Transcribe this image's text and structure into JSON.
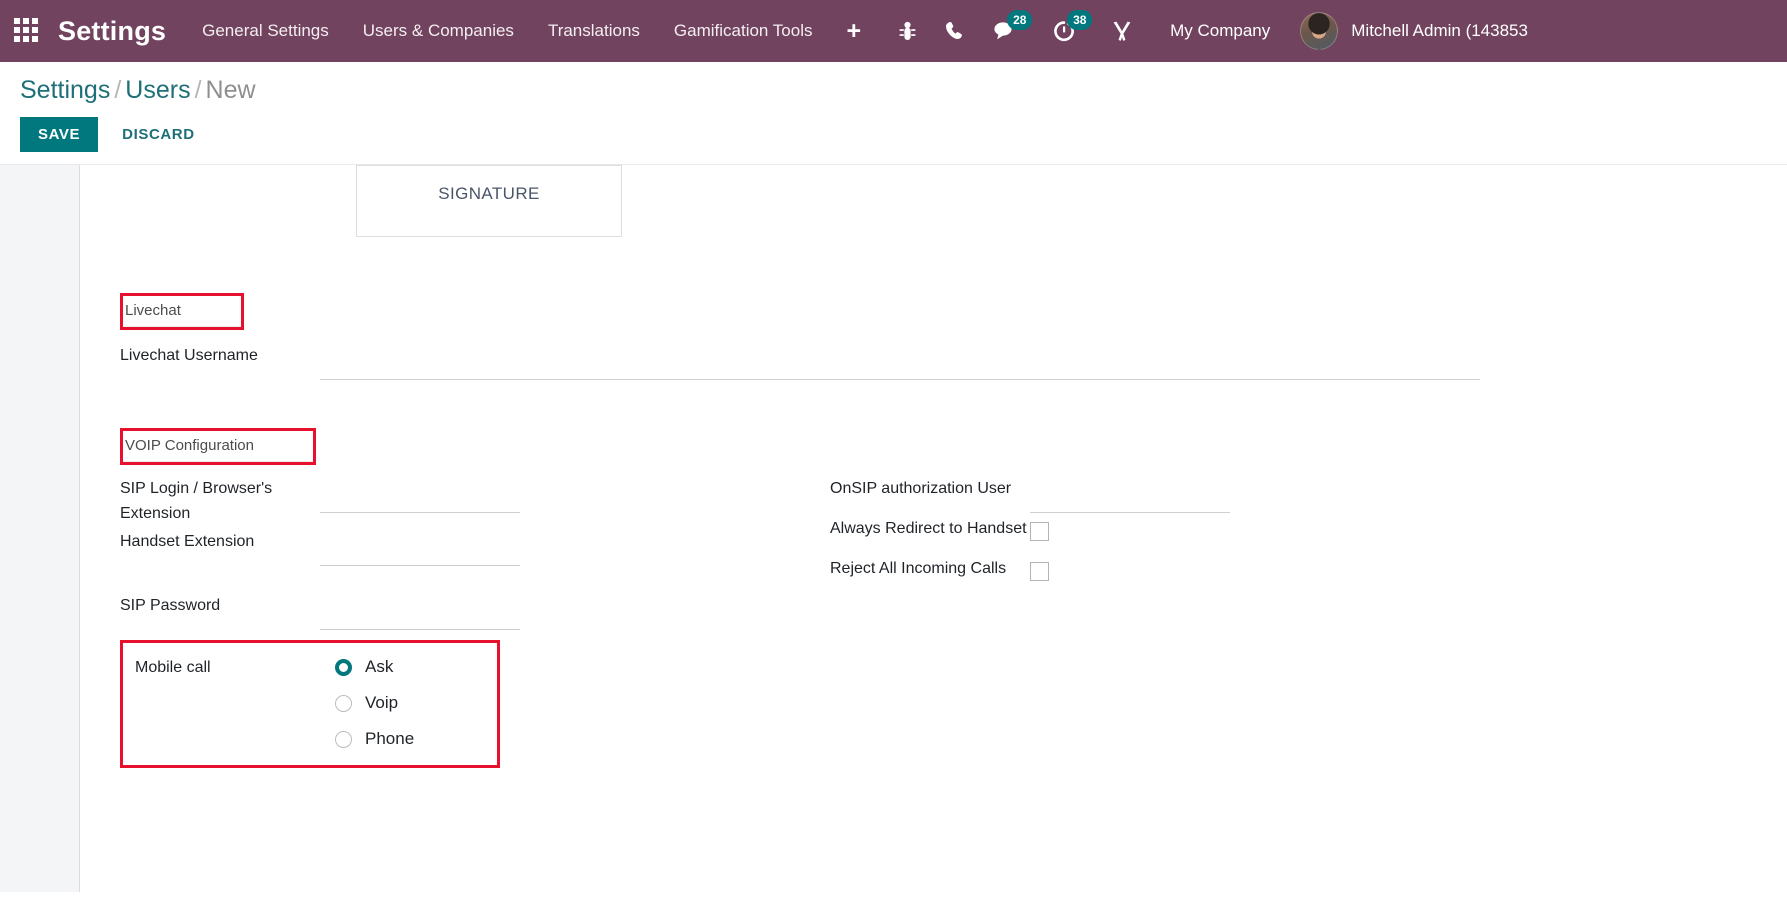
{
  "navbar": {
    "apps_icon": "apps-grid-icon",
    "brand": "Settings",
    "menu": [
      {
        "label": "General Settings"
      },
      {
        "label": "Users & Companies"
      },
      {
        "label": "Translations"
      },
      {
        "label": "Gamification Tools"
      }
    ],
    "plus_label": "+",
    "icons": [
      {
        "name": "bug-icon",
        "badge": null
      },
      {
        "name": "phone-icon",
        "badge": null
      },
      {
        "name": "messages-icon",
        "badge": "28"
      },
      {
        "name": "activities-clock-icon",
        "badge": "38"
      },
      {
        "name": "developer-tools-icon",
        "badge": null
      }
    ],
    "company": "My Company",
    "user_name": "Mitchell Admin (143853",
    "background_color": "#71435f",
    "badge_color": "#00787d"
  },
  "control_panel": {
    "breadcrumb": {
      "root": "Settings",
      "parent": "Users",
      "current": "New",
      "separator": "/"
    },
    "save_label": "SAVE",
    "discard_label": "DISCARD",
    "save_color": "#00787d"
  },
  "sheet": {
    "signature": {
      "label": "SIGNATURE"
    },
    "livechat": {
      "section_title": "Livechat",
      "username_label": "Livechat Username",
      "username_value": "",
      "username_placeholder": ""
    },
    "voip": {
      "section_title": "VOIP Configuration",
      "left_fields": [
        {
          "label": "SIP Login / Browser's Extension",
          "value": "",
          "type": "text"
        },
        {
          "label": "Handset Extension",
          "value": "",
          "type": "text"
        },
        {
          "label": "SIP Password",
          "value": "",
          "type": "password"
        }
      ],
      "right_fields": [
        {
          "label": "OnSIP authorization User",
          "value": "",
          "type": "text"
        },
        {
          "label": "Always Redirect to Handset",
          "value": "",
          "type": "checkbox",
          "checked": false
        },
        {
          "label": "Reject All Incoming Calls",
          "value": "",
          "type": "checkbox",
          "checked": false
        }
      ],
      "mobile_call": {
        "label": "Mobile call",
        "options": [
          {
            "label": "Ask",
            "selected": true
          },
          {
            "label": "Voip",
            "selected": false
          },
          {
            "label": "Phone",
            "selected": false
          }
        ]
      }
    }
  },
  "annotations": {
    "color": "#e8112d",
    "boxes": [
      "livechat-section-title",
      "voip-section-title",
      "mobile-call-radio-group"
    ]
  }
}
